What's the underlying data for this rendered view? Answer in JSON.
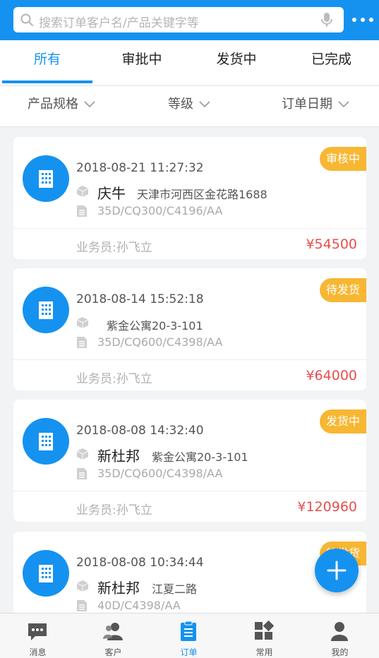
{
  "search": {
    "placeholder": "搜索订单客户名/产品关键字等"
  },
  "tabs": [
    {
      "label": "所有",
      "active": true
    },
    {
      "label": "审批中",
      "active": false
    },
    {
      "label": "发货中",
      "active": false
    },
    {
      "label": "已完成",
      "active": false
    }
  ],
  "filters": [
    {
      "label": "产品规格"
    },
    {
      "label": "等级"
    },
    {
      "label": "订单日期"
    }
  ],
  "orders": [
    {
      "datetime": "2018-08-21 11:27:32",
      "customer": "庆牛",
      "address": "天津市河西区金花路1688",
      "spec": "35D/CQ300/C4196/AA",
      "salesperson": "业务员:孙飞立",
      "amount": "¥54500",
      "status": "审核中"
    },
    {
      "datetime": "2018-08-14 15:52:18",
      "customer": "",
      "address": "紫金公寓20-3-101",
      "spec": "35D/CQ600/C4398/AA",
      "salesperson": "业务员:孙飞立",
      "amount": "¥64000",
      "status": "待发货"
    },
    {
      "datetime": "2018-08-08 14:32:40",
      "customer": "新杜邦",
      "address": "紫金公寓20-3-101",
      "spec": "35D/CQ600/C4398/AA",
      "salesperson": "业务员:孙飞立",
      "amount": "¥120960",
      "status": "发货中"
    },
    {
      "datetime": "2018-08-08 10:34:44",
      "customer": "新杜邦",
      "address": "江夏二路",
      "spec": "40D/C4398/AA",
      "salesperson": "",
      "amount": "",
      "status": "待发货"
    }
  ],
  "bottom_nav": [
    {
      "label": "消息",
      "icon": "message-icon",
      "active": false
    },
    {
      "label": "客户",
      "icon": "customers-icon",
      "active": false
    },
    {
      "label": "订单",
      "icon": "orders-icon",
      "active": true
    },
    {
      "label": "常用",
      "icon": "apps-icon",
      "active": false
    },
    {
      "label": "我的",
      "icon": "profile-icon",
      "active": false
    }
  ],
  "colors": {
    "primary": "#1592f0",
    "badge": "#f7b733",
    "amount": "#e94e4e",
    "background": "#f2f3f5"
  }
}
